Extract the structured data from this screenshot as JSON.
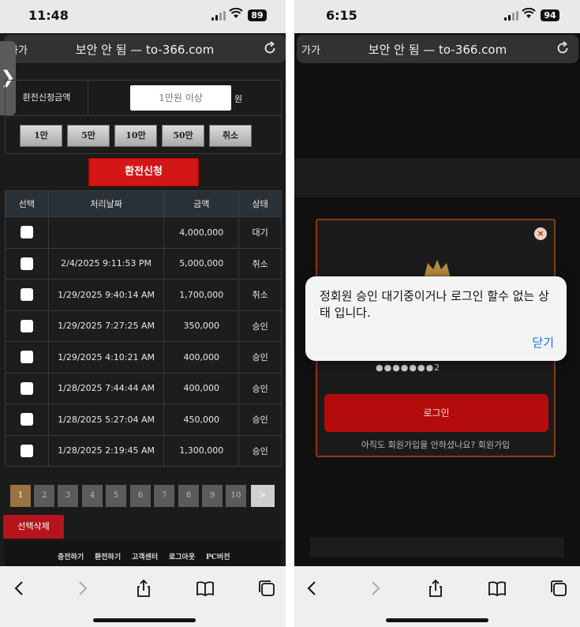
{
  "left": {
    "status": {
      "time": "11:48",
      "battery": "89"
    },
    "browser": {
      "aa": "가가",
      "url": "보안 안 됨 — to-366.com"
    },
    "drawer_handle": "❯",
    "exchange": {
      "label": "환전신청금액",
      "placeholder": "1만원 이상",
      "unit": "원",
      "quick": [
        "1만",
        "5만",
        "10만",
        "50만",
        "취소"
      ],
      "submit": "환전신청"
    },
    "table": {
      "headers": [
        "선택",
        "처리날짜",
        "금액",
        "상태"
      ],
      "rows": [
        {
          "date": "",
          "amount": "4,000,000",
          "status": "대기"
        },
        {
          "date": "2/4/2025 9:11:53 PM",
          "amount": "5,000,000",
          "status": "취소"
        },
        {
          "date": "1/29/2025 9:40:14 AM",
          "amount": "1,700,000",
          "status": "취소"
        },
        {
          "date": "1/29/2025 7:27:25 AM",
          "amount": "350,000",
          "status": "승인"
        },
        {
          "date": "1/29/2025 4:10:21 AM",
          "amount": "400,000",
          "status": "승인"
        },
        {
          "date": "1/28/2025 7:44:44 AM",
          "amount": "400,000",
          "status": "승인"
        },
        {
          "date": "1/28/2025 5:27:04 AM",
          "amount": "450,000",
          "status": "승인"
        },
        {
          "date": "1/28/2025 2:19:45 AM",
          "amount": "1,300,000",
          "status": "승인"
        }
      ]
    },
    "pager": {
      "pages": [
        "1",
        "2",
        "3",
        "4",
        "5",
        "6",
        "7",
        "8",
        "9",
        "10"
      ],
      "next": ">",
      "current": "1"
    },
    "delete_selected": "선택삭제",
    "footer": [
      "충전하기",
      "환전하기",
      "고객센터",
      "로그아웃",
      "PC버전"
    ]
  },
  "right": {
    "status": {
      "time": "6:15",
      "battery": "94"
    },
    "browser": {
      "aa": "가가",
      "url": "보안 안 됨 — to-366.com"
    },
    "modal": {
      "close": "×",
      "password_mask": "●●●●●●●2",
      "login": "로그인",
      "signup": "아직도 회원가입을 안하셨나요? 회원가입"
    },
    "alert": {
      "message": "정회원 승인 대기중이거나 로그인 할수 없는 상태 입니다.",
      "close": "닫기"
    }
  },
  "colors": {
    "accent_red": "#d31616",
    "page_active": "#9b7240",
    "alert_link": "#1a6ed8",
    "modal_border": "#8a3a15"
  }
}
